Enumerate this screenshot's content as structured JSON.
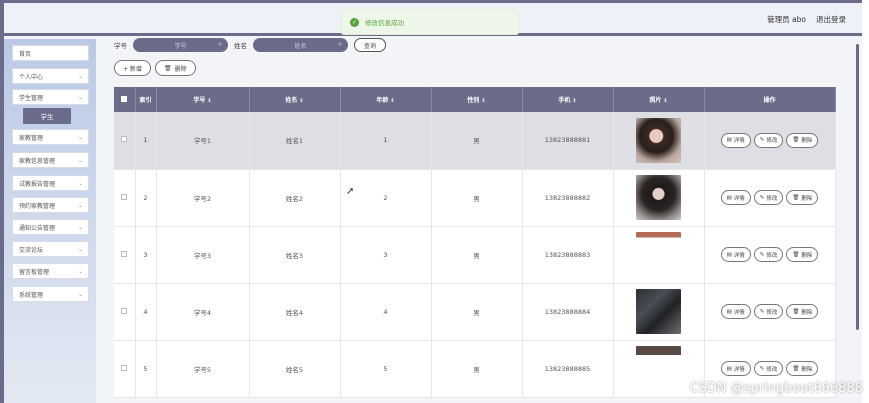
{
  "header": {
    "user_label": "管理员 abo",
    "logout_label": "退出登录"
  },
  "toast": {
    "message": "修改信息成功"
  },
  "sidebar": {
    "items": [
      {
        "label": "首页",
        "has_chevron": false
      },
      {
        "label": "个人中心",
        "has_chevron": true
      },
      {
        "label": "学生管理",
        "has_chevron": true
      },
      {
        "label": "家教管理",
        "has_chevron": true
      },
      {
        "label": "家教信息管理",
        "has_chevron": true
      },
      {
        "label": "试教报告管理",
        "has_chevron": true
      },
      {
        "label": "预约家教管理",
        "has_chevron": true
      },
      {
        "label": "通知公告管理",
        "has_chevron": true
      },
      {
        "label": "交流论坛",
        "has_chevron": true
      },
      {
        "label": "留言板管理",
        "has_chevron": true
      },
      {
        "label": "系统管理",
        "has_chevron": true
      }
    ],
    "submenu_active": "学生"
  },
  "search": {
    "field1_label": "学号",
    "field1_placeholder": "学号",
    "field2_label": "姓名",
    "field2_placeholder": "姓名",
    "query_label": "查询"
  },
  "toolbar": {
    "add_label": "+ 新增",
    "delete_label": "删除"
  },
  "table": {
    "columns": [
      "索引",
      "学号",
      "姓名",
      "年龄",
      "性别",
      "手机",
      "照片",
      "操作"
    ],
    "rows": [
      {
        "index": "1",
        "id": "学号1",
        "name": "姓名1",
        "age": "1",
        "gender": "男",
        "phone": "13823888881",
        "photo": "portrait-a"
      },
      {
        "index": "2",
        "id": "学号2",
        "name": "姓名2",
        "age": "2",
        "gender": "男",
        "phone": "13823888882",
        "photo": "portrait-b"
      },
      {
        "index": "3",
        "id": "学号3",
        "name": "姓名3",
        "age": "3",
        "gender": "男",
        "phone": "13823888883",
        "photo": "portrait-c"
      },
      {
        "index": "4",
        "id": "学号4",
        "name": "姓名4",
        "age": "4",
        "gender": "男",
        "phone": "13823888884",
        "photo": "portrait-d"
      },
      {
        "index": "5",
        "id": "学号5",
        "name": "姓名5",
        "age": "5",
        "gender": "男",
        "phone": "13823888885",
        "photo": "portrait-e"
      }
    ],
    "op_labels": {
      "detail": "详情",
      "edit": "修改",
      "delete": "删除"
    }
  },
  "watermark": "CSDN @springboot666888",
  "colors": {
    "accent": "#6b6b8a",
    "success": "#5aa33a"
  }
}
